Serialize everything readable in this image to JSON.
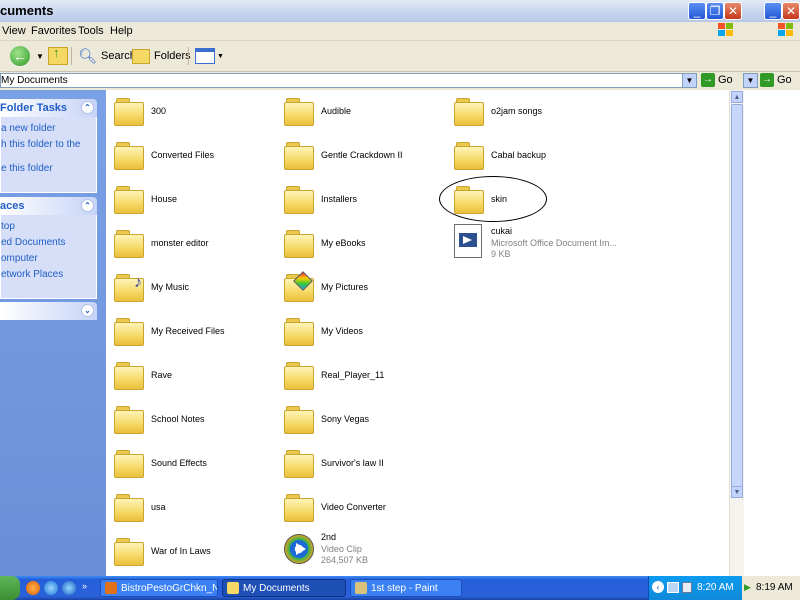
{
  "window": {
    "title": "cuments"
  },
  "menu": {
    "items": [
      "View",
      "Favorites",
      "Tools",
      "Help"
    ]
  },
  "toolbar": {
    "search": "Search",
    "folders": "Folders"
  },
  "address": {
    "value": "My Documents",
    "go": "Go",
    "go2": "Go"
  },
  "left_pane": {
    "folder_tasks": {
      "title": "Folder Tasks",
      "items": [
        "a new folder",
        "h this folder to the",
        "e this folder"
      ]
    },
    "places": {
      "title": "aces",
      "items": [
        "top",
        "ed Documents",
        "omputer",
        "etwork Places"
      ]
    }
  },
  "files": [
    {
      "name": "300"
    },
    {
      "name": "Audible"
    },
    {
      "name": "o2jam songs"
    },
    {
      "name": "Converted Files"
    },
    {
      "name": "Gentle Crackdown II"
    },
    {
      "name": "Cabal backup"
    },
    {
      "name": "House"
    },
    {
      "name": "Installers"
    },
    {
      "name": "skin"
    },
    {
      "name": "monster editor"
    },
    {
      "name": "My eBooks"
    },
    {
      "name": "cukai",
      "type": "Microsoft Office Document Im...",
      "size": "9 KB"
    },
    {
      "name": "My Music"
    },
    {
      "name": "My Pictures"
    },
    {
      "name": "My Received Files"
    },
    {
      "name": "My Videos"
    },
    {
      "name": "Rave"
    },
    {
      "name": "Real_Player_11"
    },
    {
      "name": "School Notes"
    },
    {
      "name": "Sony Vegas"
    },
    {
      "name": "Sound Effects"
    },
    {
      "name": "Survivor's law II"
    },
    {
      "name": "usa"
    },
    {
      "name": "Video Converter"
    },
    {
      "name": "War of In Laws"
    },
    {
      "name": "2nd",
      "type": "Video Clip",
      "size": "264,507 KB"
    }
  ],
  "taskbar": {
    "buttons": [
      "BistroPestoGrChkn_N...",
      "My Documents",
      "1st step - Paint"
    ],
    "clock1": "8:20 AM",
    "clock2": "8:19 AM"
  }
}
